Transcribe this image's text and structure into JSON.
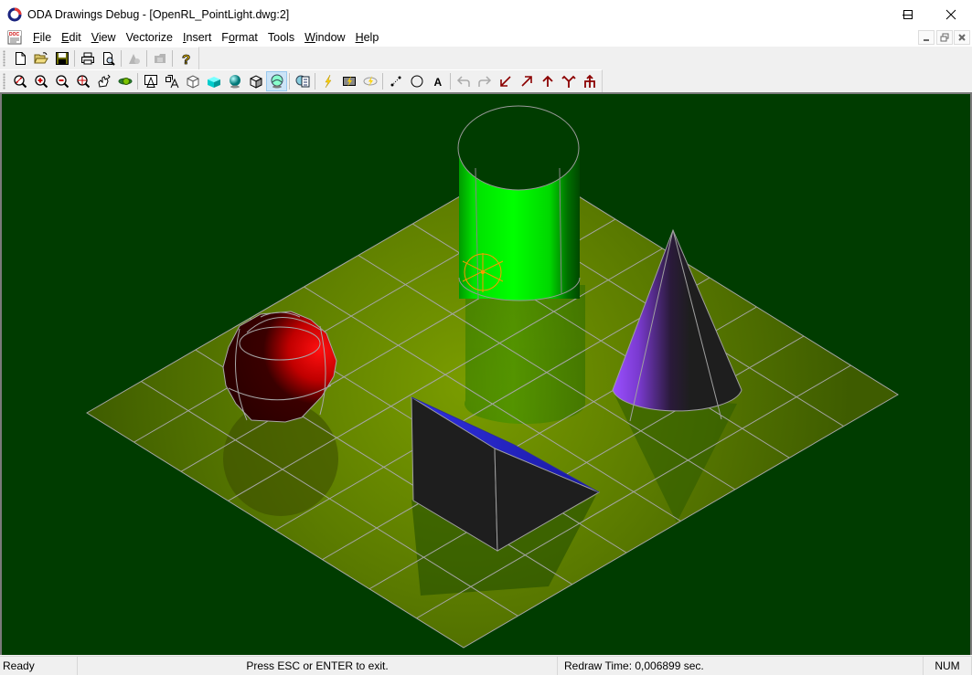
{
  "window": {
    "title": "ODA Drawings Debug - [OpenRL_PointLight.dwg:2]",
    "controls": [
      "minimize",
      "maximize",
      "close"
    ],
    "mdi_controls": [
      "minimize",
      "restore",
      "close"
    ]
  },
  "menu": {
    "items": [
      {
        "label": "File",
        "accel": "F"
      },
      {
        "label": "Edit",
        "accel": "E"
      },
      {
        "label": "View",
        "accel": "V"
      },
      {
        "label": "Vectorize",
        "accel": ""
      },
      {
        "label": "Insert",
        "accel": "I"
      },
      {
        "label": "Format",
        "accel": "o"
      },
      {
        "label": "Tools",
        "accel": ""
      },
      {
        "label": "Window",
        "accel": "W"
      },
      {
        "label": "Help",
        "accel": "H"
      }
    ]
  },
  "toolbar1": {
    "buttons": [
      {
        "icon": "new-document-icon",
        "enabled": true
      },
      {
        "icon": "open-folder-icon",
        "enabled": true
      },
      {
        "icon": "save-disk-icon",
        "enabled": true
      },
      {
        "sep": true
      },
      {
        "icon": "print-icon",
        "enabled": true
      },
      {
        "icon": "print-preview-icon",
        "enabled": true
      },
      {
        "sep": true
      },
      {
        "icon": "disabled-tool-icon",
        "enabled": false
      },
      {
        "sep": true
      },
      {
        "icon": "disabled-folder-icon",
        "enabled": false
      },
      {
        "sep": true
      },
      {
        "icon": "help-icon",
        "enabled": true
      }
    ]
  },
  "toolbar2": {
    "buttons": [
      {
        "icon": "zoom-window-icon"
      },
      {
        "icon": "zoom-in-icon"
      },
      {
        "icon": "zoom-out-icon"
      },
      {
        "icon": "zoom-extents-icon"
      },
      {
        "icon": "pan-hand-icon"
      },
      {
        "icon": "orbit-icon"
      },
      {
        "sep": true
      },
      {
        "icon": "2d-wireframe-icon"
      },
      {
        "icon": "3d-wireframe-icon"
      },
      {
        "icon": "hidden-line-icon"
      },
      {
        "icon": "flat-shaded-icon"
      },
      {
        "icon": "gouraud-shaded-icon"
      },
      {
        "icon": "flat-shaded-edges-icon"
      },
      {
        "icon": "gouraud-shaded-edges-icon",
        "active": true
      },
      {
        "sep": true
      },
      {
        "icon": "properties-icon"
      },
      {
        "sep": true
      },
      {
        "icon": "lightning-icon"
      },
      {
        "icon": "lightning-box-icon"
      },
      {
        "icon": "lightning-eye-icon"
      },
      {
        "sep": true
      },
      {
        "icon": "line-points-icon"
      },
      {
        "icon": "circle-icon"
      },
      {
        "icon": "text-icon"
      },
      {
        "sep": true
      },
      {
        "icon": "undo-icon",
        "enabled": false
      },
      {
        "icon": "redo-icon",
        "enabled": false
      },
      {
        "icon": "arrow-down-left-icon"
      },
      {
        "icon": "arrow-up-right-icon"
      },
      {
        "icon": "arrow-up-icon"
      },
      {
        "icon": "fork-icon"
      },
      {
        "icon": "hierarchy-icon"
      }
    ]
  },
  "viewport": {
    "background": "#003c00",
    "floor_color": "#6f9400",
    "grid_color": "#a6a6a6",
    "objects": [
      {
        "name": "cylinder",
        "color": "#00ff00"
      },
      {
        "name": "sphere",
        "color": "#ff0000"
      },
      {
        "name": "cone",
        "color": "#8a3cf0"
      },
      {
        "name": "wedge",
        "color": "#2a2ad8"
      },
      {
        "name": "point-light-glyph",
        "color": "#ff9900"
      }
    ]
  },
  "status": {
    "ready": "Ready",
    "prompt": "Press ESC or ENTER to exit.",
    "blank": "",
    "redraw": "Redraw Time: 0,006899 sec.",
    "blank2": "",
    "num": "NUM"
  }
}
